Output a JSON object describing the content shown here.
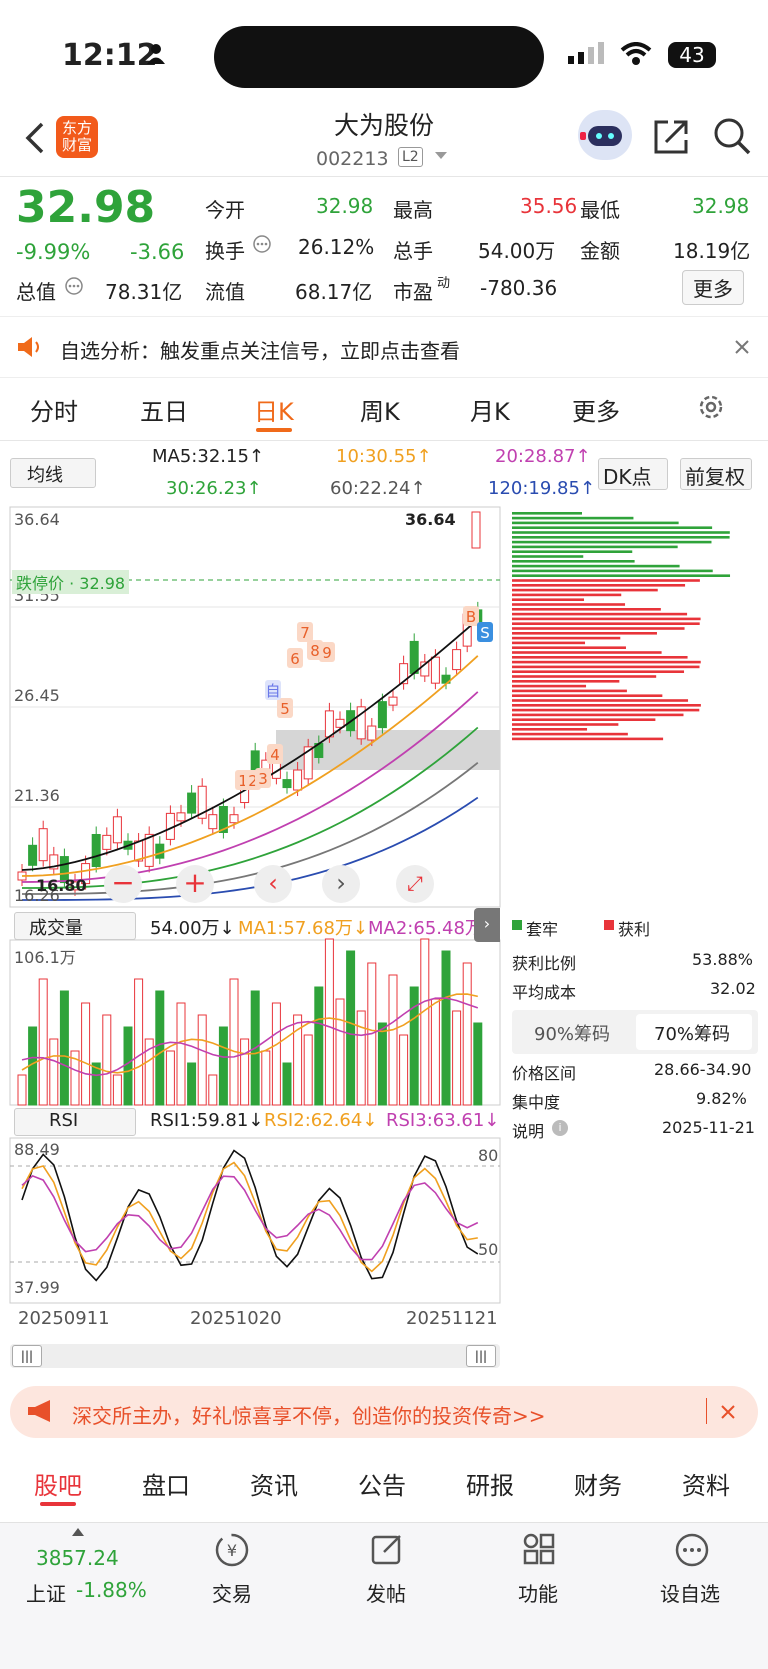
{
  "status": {
    "time": "12:12",
    "battery": "43"
  },
  "header": {
    "logo": "东方\n财富",
    "title": "大为股份",
    "code": "002213",
    "level": "L2"
  },
  "quote": {
    "price": "32.98",
    "pct": "-9.99%",
    "chg": "-3.66",
    "fields": [
      [
        "今开",
        "32.98"
      ],
      [
        "最高",
        "35.56"
      ],
      [
        "最低",
        "32.98"
      ],
      [
        "换手",
        "26.12%"
      ],
      [
        "总手",
        "54.00万"
      ],
      [
        "金额",
        "18.19亿"
      ],
      [
        "总值",
        "78.31亿"
      ],
      [
        "流值",
        "68.17亿"
      ],
      [
        "市盈",
        "-780.36"
      ]
    ],
    "more": "更多",
    "pe_sup": "动"
  },
  "notice": {
    "text": "自选分析：触发重点关注信号，立即点击查看"
  },
  "tabs": [
    "分时",
    "五日",
    "日K",
    "周K",
    "月K",
    "更多"
  ],
  "ma_bar": {
    "select": "均线",
    "ma5": "MA5:32.15↑",
    "ma10": "10:30.55↑",
    "ma20": "20:28.87↑",
    "ma30": "30:26.23↑",
    "ma60": "60:22.24↑",
    "ma120": "120:19.85↑",
    "dk": "DK点",
    "adj": "前复权"
  },
  "kline": {
    "y_labels": [
      "36.64",
      "31.55",
      "26.45",
      "21.36",
      "16.26"
    ],
    "limit_label": "跌停价",
    "limit_value": "32.98",
    "high_label": "36.64",
    "low_label": "16.80",
    "marks": [
      "1",
      "2",
      "3",
      "4",
      "5",
      "6",
      "7",
      "8",
      "9",
      "自",
      "B",
      "S"
    ]
  },
  "volume": {
    "select": "成交量",
    "vol": "54.00万↓",
    "ma1": "MA1:57.68万↓",
    "ma2": "MA2:65.48万↓",
    "top": "106.1万"
  },
  "rsi": {
    "select": "RSI",
    "rsi1": "RSI1:59.81↓",
    "rsi2": "RSI2:62.64↓",
    "rsi3": "RSI3:63.61↓",
    "top": "88.49",
    "bottom": "37.99",
    "l80": "80",
    "l50": "50"
  },
  "dates": [
    "20250911",
    "20251020",
    "20251121"
  ],
  "chips": {
    "legend1": "套牢",
    "legend2": "获利",
    "rows": [
      [
        "获利比例",
        "53.88%"
      ],
      [
        "平均成本",
        "32.02"
      ]
    ],
    "tab1": "90%筹码",
    "tab2": "70%筹码",
    "rows2": [
      [
        "价格区间",
        "28.66-34.90"
      ],
      [
        "集中度",
        "9.82%"
      ],
      [
        "说明",
        "2025-11-21"
      ]
    ]
  },
  "banner": {
    "text": "深交所主办，好礼惊喜享不停，创造你的投资传奇>>"
  },
  "bottom_tabs": [
    "股吧",
    "盘口",
    "资讯",
    "公告",
    "研报",
    "财务",
    "资料"
  ],
  "nav": {
    "index_value": "3857.24",
    "index_name": "上证",
    "index_pct": "-1.88%",
    "items": [
      "交易",
      "发帖",
      "功能",
      "设自选"
    ]
  },
  "colors": {
    "up": "#e8343a",
    "down": "#2fa33a",
    "accent": "#f06a1a"
  },
  "chart_data": {
    "type": "candlestick",
    "note_unused": ""
  }
}
